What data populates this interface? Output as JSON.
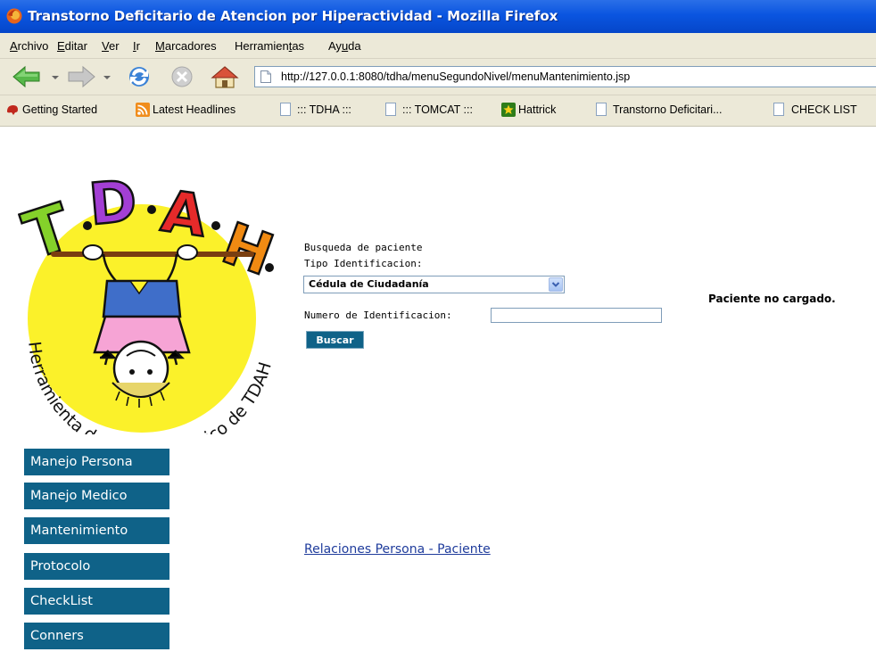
{
  "window": {
    "title": "Transtorno Deficitario de Atencion por Hiperactividad - Mozilla Firefox"
  },
  "menu": {
    "archivo": {
      "pre": "",
      "u": "A",
      "post": "rchivo"
    },
    "editar": {
      "pre": "",
      "u": "E",
      "post": "ditar"
    },
    "ver": {
      "pre": "",
      "u": "V",
      "post": "er"
    },
    "ir": {
      "pre": "",
      "u": "I",
      "post": "r"
    },
    "marcadores": {
      "pre": "",
      "u": "M",
      "post": "arcadores"
    },
    "herramientas": {
      "pre": "Herramien",
      "u": "t",
      "post": "as"
    },
    "ayuda": {
      "pre": "Ay",
      "u": "u",
      "post": "da"
    }
  },
  "nav": {
    "url": "http://127.0.0.1:8080/tdha/menuSegundoNivel/menuMantenimiento.jsp"
  },
  "bookmarks": [
    {
      "label": "Getting Started"
    },
    {
      "label": "Latest Headlines"
    },
    {
      "label": "::: TDHA :::"
    },
    {
      "label": "::: TOMCAT :::"
    },
    {
      "label": "Hattrick"
    },
    {
      "label": "Transtorno Deficitari..."
    },
    {
      "label": "CHECK LIST"
    }
  ],
  "logo": {
    "letters": [
      "T",
      "D",
      "A",
      "H"
    ],
    "tagline": "Herramienta de Pre-diagnostico de TDAH"
  },
  "sidebar": {
    "items": [
      {
        "label": "Manejo Persona"
      },
      {
        "label": "Manejo Medico"
      },
      {
        "label": "Mantenimiento"
      },
      {
        "label": "Protocolo"
      },
      {
        "label": "CheckList"
      },
      {
        "label": "Conners"
      }
    ]
  },
  "search": {
    "heading": "Busqueda de paciente",
    "tipo_label": "Tipo Identificacion:",
    "tipo_value": "Cédula de Ciudadanía",
    "numero_label": "Numero de Identificacion:",
    "numero_value": "",
    "button": "Buscar"
  },
  "status": "Paciente no cargado.",
  "link": "Relaciones Persona - Paciente",
  "colors": {
    "titlebar": "#0a55e0",
    "chrome": "#ece9d8",
    "button_bg": "#0f6288",
    "link": "#1f3c9c",
    "logo_circle": "#fbf12a"
  }
}
